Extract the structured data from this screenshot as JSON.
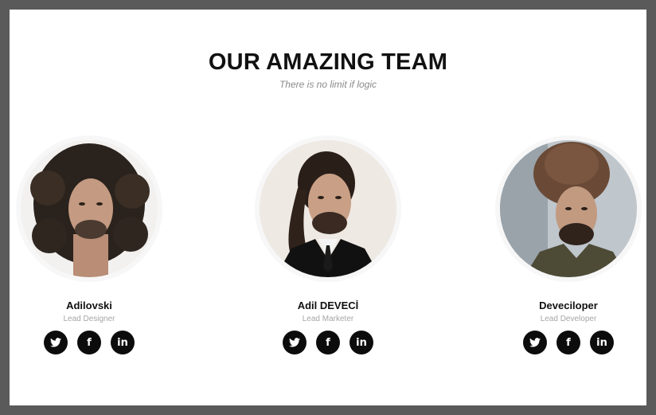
{
  "header": {
    "title": "OUR AMAZING TEAM",
    "subtitle": "There is no limit if logic"
  },
  "team": [
    {
      "name": "Adilovski",
      "role": "Lead Designer",
      "social": [
        "twitter-icon",
        "facebook-icon",
        "linkedin-icon"
      ]
    },
    {
      "name": "Adil DEVECİ",
      "role": "Lead Marketer",
      "social": [
        "twitter-icon",
        "facebook-icon",
        "linkedin-icon"
      ]
    },
    {
      "name": "Deveciloper",
      "role": "Lead Developer",
      "social": [
        "twitter-icon",
        "facebook-icon",
        "linkedin-icon"
      ]
    }
  ],
  "social_labels": {
    "facebook": "f",
    "linkedin": "in"
  },
  "colors": {
    "frame_border": "#5a5a5a",
    "background": "#ffffff",
    "title": "#111111",
    "subtitle": "#8a8a8a",
    "social_button": "#0c0c0c"
  }
}
